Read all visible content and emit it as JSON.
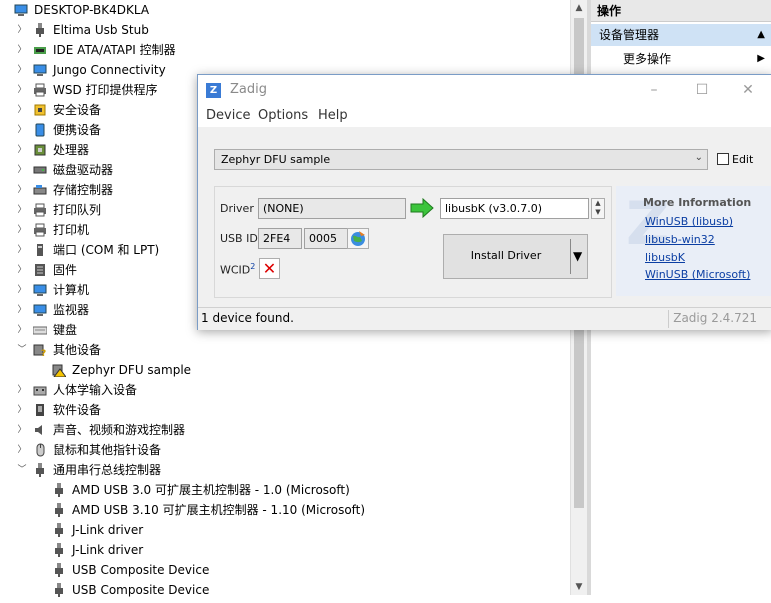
{
  "tree": {
    "root": "DESKTOP-BK4DKLA",
    "items": [
      {
        "label": "Eltima Usb Stub",
        "chev": "›",
        "indent": 1,
        "icon": "usb-plug-icon"
      },
      {
        "label": "IDE ATA/ATAPI 控制器",
        "chev": "›",
        "indent": 1,
        "icon": "ide-controller-icon"
      },
      {
        "label": "Jungo Connectivity",
        "chev": "›",
        "indent": 1,
        "icon": "monitor-icon"
      },
      {
        "label": "WSD 打印提供程序",
        "chev": "›",
        "indent": 1,
        "icon": "printer-icon"
      },
      {
        "label": "安全设备",
        "chev": "›",
        "indent": 1,
        "icon": "security-icon"
      },
      {
        "label": "便携设备",
        "chev": "›",
        "indent": 1,
        "icon": "portable-device-icon"
      },
      {
        "label": "处理器",
        "chev": "›",
        "indent": 1,
        "icon": "processor-icon"
      },
      {
        "label": "磁盘驱动器",
        "chev": "›",
        "indent": 1,
        "icon": "disk-drive-icon"
      },
      {
        "label": "存储控制器",
        "chev": "›",
        "indent": 1,
        "icon": "storage-controller-icon"
      },
      {
        "label": "打印队列",
        "chev": "›",
        "indent": 1,
        "icon": "printer-icon"
      },
      {
        "label": "打印机",
        "chev": "›",
        "indent": 1,
        "icon": "printer-icon"
      },
      {
        "label": "端口 (COM 和 LPT)",
        "chev": "›",
        "indent": 1,
        "icon": "port-icon"
      },
      {
        "label": "固件",
        "chev": "›",
        "indent": 1,
        "icon": "firmware-icon"
      },
      {
        "label": "计算机",
        "chev": "›",
        "indent": 1,
        "icon": "computer-icon"
      },
      {
        "label": "监视器",
        "chev": "›",
        "indent": 1,
        "icon": "monitor-icon"
      },
      {
        "label": "键盘",
        "chev": "›",
        "indent": 1,
        "icon": "keyboard-icon"
      },
      {
        "label": "其他设备",
        "chev": "⌄",
        "indent": 1,
        "icon": "other-device-icon"
      },
      {
        "label": "Zephyr DFU sample",
        "chev": "",
        "indent": 2,
        "icon": "warning-device-icon"
      },
      {
        "label": "人体学输入设备",
        "chev": "›",
        "indent": 1,
        "icon": "hid-icon"
      },
      {
        "label": "软件设备",
        "chev": "›",
        "indent": 1,
        "icon": "software-device-icon"
      },
      {
        "label": "声音、视频和游戏控制器",
        "chev": "›",
        "indent": 1,
        "icon": "speaker-icon"
      },
      {
        "label": "鼠标和其他指针设备",
        "chev": "›",
        "indent": 1,
        "icon": "mouse-icon"
      },
      {
        "label": "通用串行总线控制器",
        "chev": "⌄",
        "indent": 1,
        "icon": "usb-plug-icon"
      },
      {
        "label": "AMD USB 3.0 可扩展主机控制器 - 1.0 (Microsoft)",
        "chev": "",
        "indent": 2,
        "icon": "usb-plug-icon"
      },
      {
        "label": "AMD USB 3.10 可扩展主机控制器 - 1.10 (Microsoft)",
        "chev": "",
        "indent": 2,
        "icon": "usb-plug-icon"
      },
      {
        "label": "J-Link driver",
        "chev": "",
        "indent": 2,
        "icon": "usb-plug-icon"
      },
      {
        "label": "J-Link driver",
        "chev": "",
        "indent": 2,
        "icon": "usb-plug-icon"
      },
      {
        "label": "USB Composite Device",
        "chev": "",
        "indent": 2,
        "icon": "usb-plug-icon"
      },
      {
        "label": "USB Composite Device",
        "chev": "",
        "indent": 2,
        "icon": "usb-plug-icon"
      }
    ]
  },
  "actions": {
    "header": "操作",
    "selected": "设备管理器",
    "more": "更多操作"
  },
  "zadig": {
    "title": "Zadig",
    "menu": [
      "Device",
      "Options",
      "Help"
    ],
    "device_selected": "Zephyr DFU sample",
    "edit_label": "Edit",
    "driver_label": "Driver",
    "driver_current": "(NONE)",
    "driver_target": "libusbK (v3.0.7.0)",
    "usbid_label": "USB ID",
    "vid": "2FE4",
    "pid": "0005",
    "wcid_label": "WCID",
    "wcid_sup": "2",
    "install_label": "Install Driver",
    "info_title": "More Information",
    "info_links": [
      "WinUSB (libusb)",
      "libusb-win32",
      "libusbK",
      "WinUSB (Microsoft)"
    ],
    "status": "1 device found.",
    "version": "Zadig 2.4.721"
  }
}
